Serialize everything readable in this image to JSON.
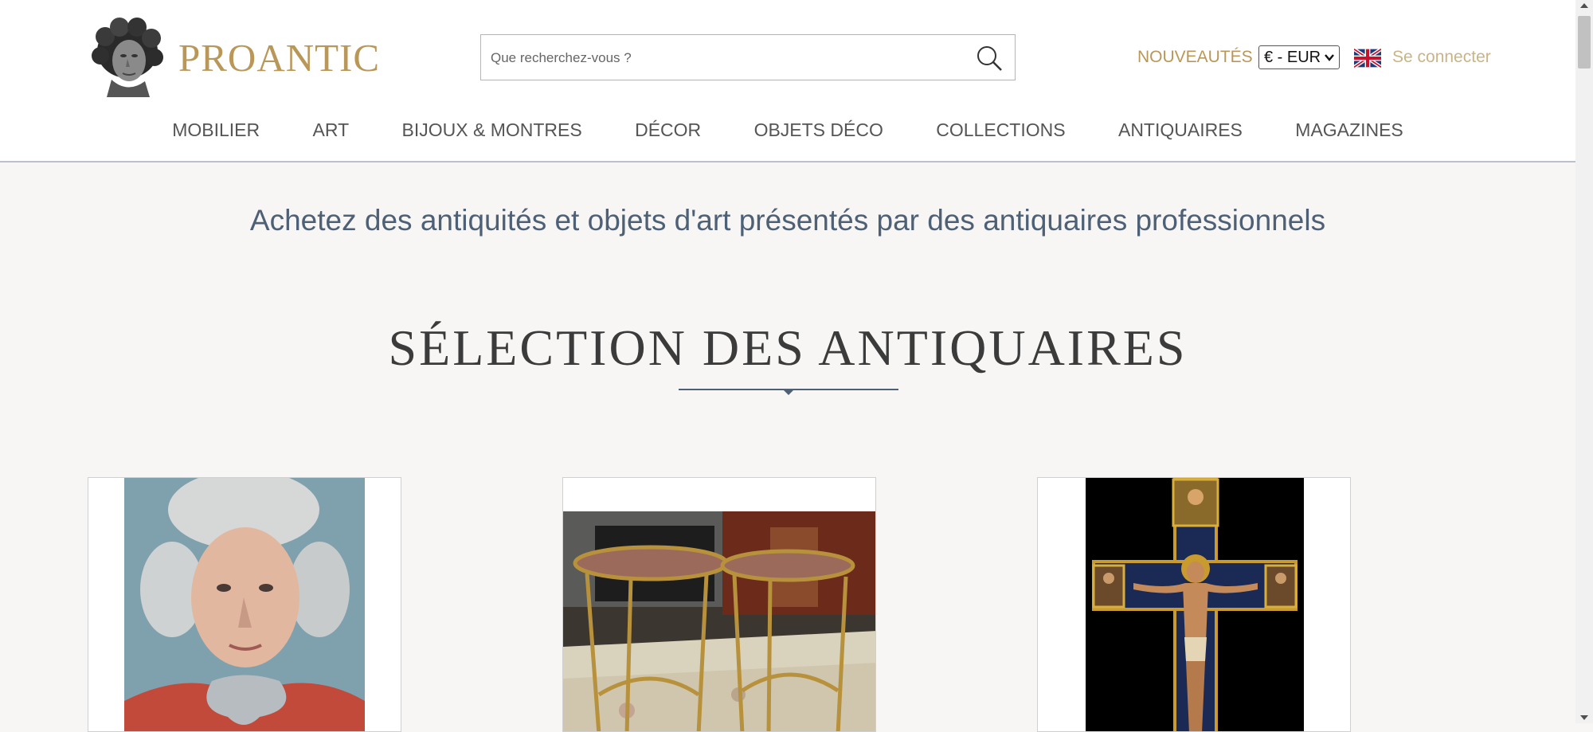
{
  "brand": {
    "name": "PROANTIC"
  },
  "search": {
    "placeholder": "Que recherchez-vous ?"
  },
  "header": {
    "new_label": "NOUVEAUTÉS",
    "currency": "€ - EUR",
    "login_label": "Se connecter",
    "language_flag": "uk-flag-icon"
  },
  "nav": {
    "items": [
      {
        "label": "MOBILIER"
      },
      {
        "label": "ART"
      },
      {
        "label": "BIJOUX & MONTRES"
      },
      {
        "label": "DÉCOR"
      },
      {
        "label": "OBJETS DÉCO"
      },
      {
        "label": "COLLECTIONS"
      },
      {
        "label": "ANTIQUAIRES"
      },
      {
        "label": "MAGAZINES"
      }
    ]
  },
  "main": {
    "tagline": "Achetez des antiquités et objets d'art présentés par des antiquaires professionnels",
    "section_title": "SÉLECTION DES ANTIQUAIRES"
  },
  "colors": {
    "gold": "#b99758",
    "gold_light": "#c9b486",
    "slate": "#4e6076",
    "background": "#f7f6f4"
  }
}
